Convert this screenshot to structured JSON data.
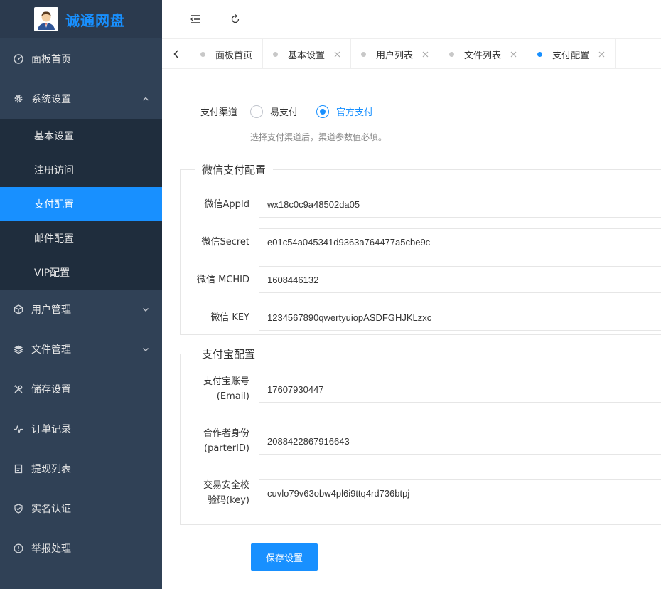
{
  "brand": {
    "title": "诚通网盘"
  },
  "sidebar": {
    "items": [
      {
        "label": "面板首页",
        "icon": "dashboard-icon"
      },
      {
        "label": "系统设置",
        "icon": "gear-icon",
        "expanded": true,
        "children": [
          {
            "label": "基本设置"
          },
          {
            "label": "注册访问"
          },
          {
            "label": "支付配置",
            "active": true
          },
          {
            "label": "邮件配置"
          },
          {
            "label": "VIP配置"
          }
        ]
      },
      {
        "label": "用户管理",
        "icon": "cube-icon"
      },
      {
        "label": "文件管理",
        "icon": "layers-icon"
      },
      {
        "label": "储存设置",
        "icon": "tools-icon"
      },
      {
        "label": "订单记录",
        "icon": "pulse-icon"
      },
      {
        "label": "提现列表",
        "icon": "list-doc-icon"
      },
      {
        "label": "实名认证",
        "icon": "shield-check-icon"
      },
      {
        "label": "举报处理",
        "icon": "alert-circle-icon"
      }
    ]
  },
  "tabs": [
    {
      "label": "面板首页",
      "closable": false
    },
    {
      "label": "基本设置",
      "closable": true
    },
    {
      "label": "用户列表",
      "closable": true
    },
    {
      "label": "文件列表",
      "closable": true
    },
    {
      "label": "支付配置",
      "closable": true,
      "active": true
    }
  ],
  "form": {
    "channel_label": "支付渠道",
    "channel_options": [
      "易支付",
      "官方支付"
    ],
    "channel_selected": "官方支付",
    "channel_hint": "选择支付渠道后，渠道参数值必填。",
    "wechat": {
      "legend": "微信支付配置",
      "fields": [
        {
          "label": "微信AppId",
          "value": "wx18c0c9a48502da05"
        },
        {
          "label": "微信Secret",
          "value": "e01c54a045341d9363a764477a5cbe9c"
        },
        {
          "label": "微信 MCHID",
          "value": "1608446132"
        },
        {
          "label": "微信 KEY",
          "value": "1234567890qwertyuiopASDFGHJKLzxc"
        }
      ]
    },
    "alipay": {
      "legend": "支付宝配置",
      "fields": [
        {
          "label1": "支付宝账号",
          "label2": "(Email)",
          "value": "17607930447"
        },
        {
          "label1": "合作者身份",
          "label2": "(parterID)",
          "value": "2088422867916643"
        },
        {
          "label1": "交易安全校",
          "label2": "验码(key)",
          "value": "cuvlo79v63obw4pl6i9ttq4rd736btpj"
        }
      ]
    },
    "save_label": "保存设置"
  },
  "colors": {
    "sidebar_bg": "#304156",
    "submenu_bg": "#1f2d3d",
    "accent": "#1890ff"
  }
}
